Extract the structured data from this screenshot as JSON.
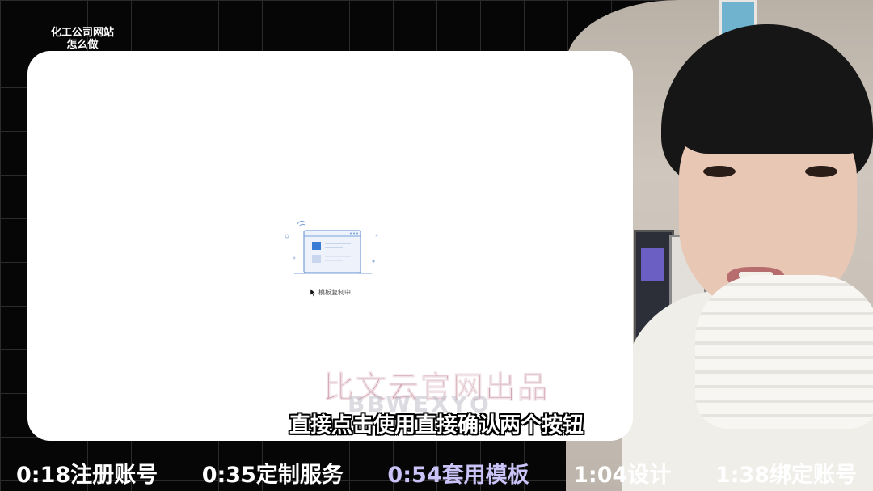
{
  "video_title": [
    "化工公司网站",
    "怎么做"
  ],
  "loader": {
    "status_text": "模板复制中..."
  },
  "watermark": {
    "line1": "比文云官网出品",
    "line2": "BBWEXYQ"
  },
  "subtitle": "直接点击使用直接确认两个按钮",
  "chapters": [
    {
      "time": "0:18",
      "label": "注册账号"
    },
    {
      "time": "0:35",
      "label": "定制服务"
    },
    {
      "time": "0:54",
      "label": "套用模板",
      "active": true
    },
    {
      "time": "1:04",
      "label": "设计"
    },
    {
      "time": "1:38",
      "label": "绑定账号"
    }
  ],
  "colors": {
    "active_chapter": "#c9c3f7",
    "loader_blue": "#3a7bd5",
    "watermark_pink": "#c68c9b"
  }
}
